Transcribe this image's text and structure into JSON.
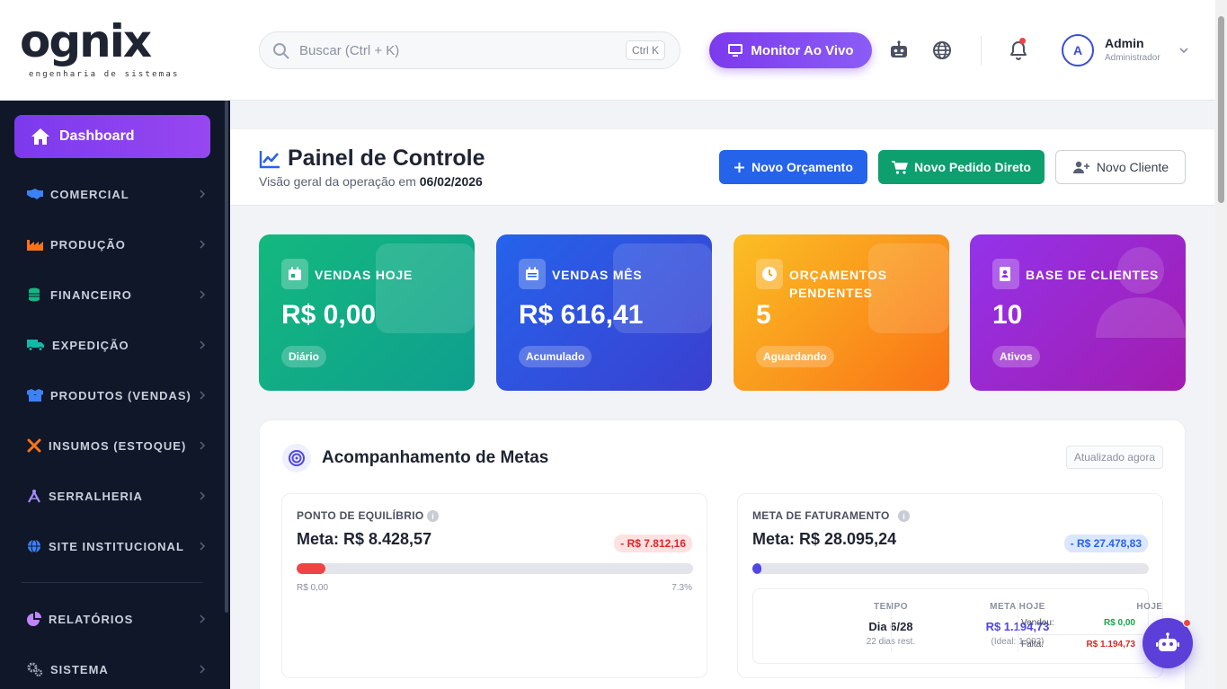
{
  "brand": {
    "word": "ognix",
    "tagline": "engenharia de sistemas"
  },
  "search": {
    "placeholder": "Buscar (Ctrl + K)",
    "shortcut": "Ctrl K"
  },
  "topbar": {
    "monitor_label": "Monitor Ao Vivo",
    "icons": [
      "robot-icon",
      "globe-icon",
      "bell-icon"
    ],
    "user": {
      "initial": "A",
      "name": "Admin",
      "role": "Administrador"
    }
  },
  "sidebar": {
    "dashboard_label": "Dashboard",
    "items": [
      {
        "label": "COMERCIAL",
        "icon": "handshake-icon",
        "color": "#3b82f6"
      },
      {
        "label": "PRODUÇÃO",
        "icon": "industry-icon",
        "color": "#f97316"
      },
      {
        "label": "FINANCEIRO",
        "icon": "coins-icon",
        "color": "#10b981"
      },
      {
        "label": "EXPEDIÇÃO",
        "icon": "truck-icon",
        "color": "#14b8a6"
      },
      {
        "label": "PRODUTOS (VENDAS)",
        "icon": "boxes-icon",
        "color": "#3b82f6"
      },
      {
        "label": "INSUMOS (ESTOQUE)",
        "icon": "tools-icon",
        "color": "#f97316"
      },
      {
        "label": "SERRALHERIA",
        "icon": "compass-icon",
        "color": "#a78bfa"
      },
      {
        "label": "SITE INSTITUCIONAL",
        "icon": "globe-icon",
        "color": "#3b82f6"
      },
      {
        "label": "RELATÓRIOS",
        "icon": "pie-chart-icon",
        "color": "#c084fc"
      },
      {
        "label": "SISTEMA",
        "icon": "gears-icon",
        "color": "#9ca3af"
      }
    ]
  },
  "header": {
    "title": "Painel de Controle",
    "subtitle_prefix": "Visão geral da operação em",
    "date": "06/02/2026",
    "buttons": {
      "orcamento": "Novo Orçamento",
      "pedido": "Novo Pedido Direto",
      "cliente": "Novo Cliente"
    }
  },
  "stats": [
    {
      "label": "VENDAS HOJE",
      "value": "R$ 0,00",
      "pill": "Diário",
      "color_from": "#10b981",
      "color_to": "#0e9f8e"
    },
    {
      "label": "VENDAS MÊS",
      "value": "R$ 616,41",
      "pill": "Acumulado",
      "color_from": "#2563eb",
      "color_to": "#3b3fd0"
    },
    {
      "label": "ORÇAMENTOS PENDENTES",
      "value": "5",
      "pill": "Aguardando",
      "color_from": "#fbbf24",
      "color_to": "#f97316"
    },
    {
      "label": "BASE DE CLIENTES",
      "value": "10",
      "pill": "Ativos",
      "color_from": "#9333ea",
      "color_to": "#a21caf"
    }
  ],
  "goals": {
    "title": "Acompanhamento de Metas",
    "updated": "Atualizado agora",
    "equilibrio": {
      "title": "PONTO DE EQUILÍBRIO",
      "meta": "Meta: R$ 8.428,57",
      "diff": "- R$ 7.812,16",
      "progress": 0.073,
      "low_label": "R$ 0,00",
      "percent_label": "7.3%"
    },
    "faturamento": {
      "title": "META DE FATURAMENTO",
      "meta": "Meta: R$ 28.095,24",
      "diff": "- R$ 27.478,83",
      "progress": 0.022,
      "tempo": {
        "header": "TEMPO",
        "value": "Dia 6/28",
        "sub": "22 dias rest."
      },
      "meta_hoje": {
        "header": "META HOJE",
        "value": "R$ 1.194,73",
        "sub": "(Ideal: 1.003)"
      },
      "hoje": {
        "header": "HOJE",
        "vendeu_label": "Vendeu:",
        "vendeu": "R$ 0,00",
        "falta_label": "Falta:",
        "falta": "R$ 1.194,73"
      }
    }
  }
}
